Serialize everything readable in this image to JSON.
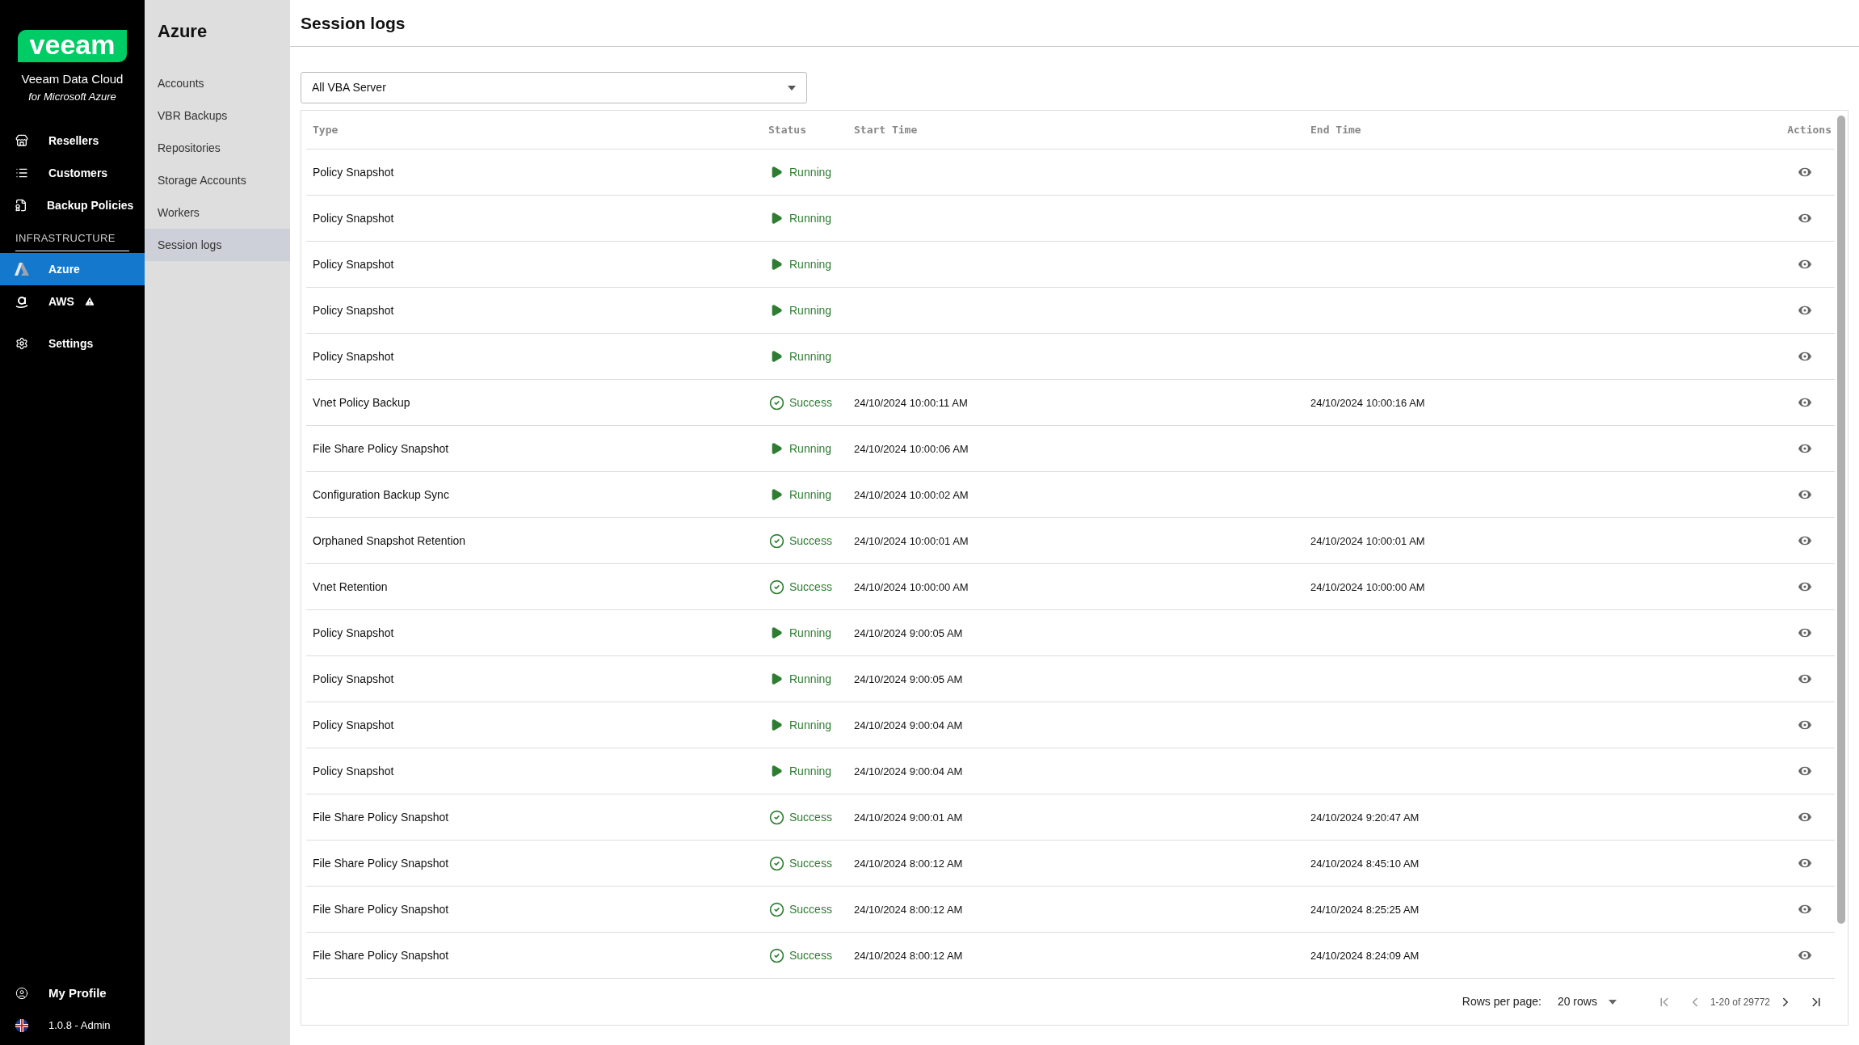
{
  "sidebar": {
    "logo": "veeam",
    "product": "Veeam Data Cloud",
    "product_sub": "for Microsoft Azure",
    "items": [
      {
        "label": "Resellers",
        "kind": "store",
        "selected": false
      },
      {
        "label": "Customers",
        "kind": "list",
        "selected": false
      },
      {
        "label": "Backup Policies",
        "kind": "policy",
        "selected": false
      }
    ],
    "section": "INFRASTRUCTURE",
    "infra_items": [
      {
        "label": "Azure",
        "kind": "azure",
        "selected": true,
        "warning": false
      },
      {
        "label": "AWS",
        "kind": "aws",
        "selected": false,
        "warning": true
      }
    ],
    "settings": {
      "label": "Settings",
      "kind": "gear",
      "selected": false
    },
    "footer": [
      {
        "label": "My Profile",
        "kind": "user"
      },
      {
        "label": "1.0.8 - Admin",
        "kind": "flag"
      }
    ]
  },
  "subnav": {
    "title": "Azure",
    "items": [
      {
        "label": "Accounts",
        "selected": false
      },
      {
        "label": "VBR Backups",
        "selected": false
      },
      {
        "label": "Repositories",
        "selected": false
      },
      {
        "label": "Storage Accounts",
        "selected": false
      },
      {
        "label": "Workers",
        "selected": false
      },
      {
        "label": "Session logs",
        "selected": true
      }
    ]
  },
  "page": {
    "title": "Session logs",
    "filter": {
      "value": "All VBA Server"
    }
  },
  "table": {
    "columns": [
      "Type",
      "Status",
      "Start Time",
      "End Time",
      "Actions"
    ],
    "rows": [
      {
        "type": "Policy Snapshot",
        "status": "Running",
        "kind": "running",
        "start": "",
        "end": ""
      },
      {
        "type": "Policy Snapshot",
        "status": "Running",
        "kind": "running",
        "start": "",
        "end": ""
      },
      {
        "type": "Policy Snapshot",
        "status": "Running",
        "kind": "running",
        "start": "",
        "end": ""
      },
      {
        "type": "Policy Snapshot",
        "status": "Running",
        "kind": "running",
        "start": "",
        "end": ""
      },
      {
        "type": "Policy Snapshot",
        "status": "Running",
        "kind": "running",
        "start": "",
        "end": ""
      },
      {
        "type": "Vnet Policy Backup",
        "status": "Success",
        "kind": "success",
        "start": "24/10/2024 10:00:11 AM",
        "end": "24/10/2024 10:00:16 AM"
      },
      {
        "type": "File Share Policy Snapshot",
        "status": "Running",
        "kind": "running",
        "start": "24/10/2024 10:00:06 AM",
        "end": ""
      },
      {
        "type": "Configuration Backup Sync",
        "status": "Running",
        "kind": "running",
        "start": "24/10/2024 10:00:02 AM",
        "end": ""
      },
      {
        "type": "Orphaned Snapshot Retention",
        "status": "Success",
        "kind": "success",
        "start": "24/10/2024 10:00:01 AM",
        "end": "24/10/2024 10:00:01 AM"
      },
      {
        "type": "Vnet Retention",
        "status": "Success",
        "kind": "success",
        "start": "24/10/2024 10:00:00 AM",
        "end": "24/10/2024 10:00:00 AM"
      },
      {
        "type": "Policy Snapshot",
        "status": "Running",
        "kind": "running",
        "start": "24/10/2024 9:00:05 AM",
        "end": ""
      },
      {
        "type": "Policy Snapshot",
        "status": "Running",
        "kind": "running",
        "start": "24/10/2024 9:00:05 AM",
        "end": ""
      },
      {
        "type": "Policy Snapshot",
        "status": "Running",
        "kind": "running",
        "start": "24/10/2024 9:00:04 AM",
        "end": ""
      },
      {
        "type": "Policy Snapshot",
        "status": "Running",
        "kind": "running",
        "start": "24/10/2024 9:00:04 AM",
        "end": ""
      },
      {
        "type": "File Share Policy Snapshot",
        "status": "Success",
        "kind": "success",
        "start": "24/10/2024 9:00:01 AM",
        "end": "24/10/2024 9:20:47 AM"
      },
      {
        "type": "File Share Policy Snapshot",
        "status": "Success",
        "kind": "success",
        "start": "24/10/2024 8:00:12 AM",
        "end": "24/10/2024 8:45:10 AM"
      },
      {
        "type": "File Share Policy Snapshot",
        "status": "Success",
        "kind": "success",
        "start": "24/10/2024 8:00:12 AM",
        "end": "24/10/2024 8:25:25 AM"
      },
      {
        "type": "File Share Policy Snapshot",
        "status": "Success",
        "kind": "success",
        "start": "24/10/2024 8:00:12 AM",
        "end": "24/10/2024 8:24:09 AM"
      }
    ]
  },
  "pagination": {
    "rows_label": "Rows per page:",
    "rows_value": "20 rows",
    "range": "1-20 of 29772"
  }
}
